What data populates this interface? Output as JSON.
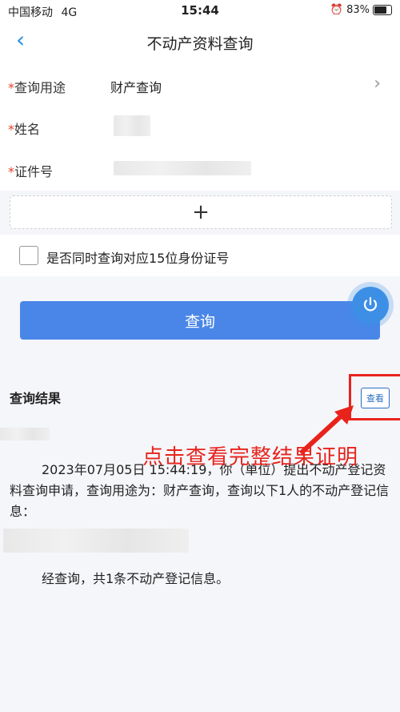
{
  "statusbar": {
    "carrier": "中国移动",
    "network": "4G",
    "time": "15:44",
    "battery": "83%"
  },
  "nav": {
    "title": "不动产资料查询"
  },
  "form": {
    "required_mark": "*",
    "purpose_label": "查询用途",
    "purpose_value": "财产查询",
    "name_label": "姓名",
    "id_label": "证件号"
  },
  "add": {
    "symbol": "+"
  },
  "checkbox": {
    "label": "是否同时查询对应15位身份证号",
    "checked": false
  },
  "query_button": {
    "label": "查询"
  },
  "results": {
    "title": "查询结果",
    "view_label": "查看",
    "paragraph": "2023年07月05日 15:44:19，你（单位）提出不动产登记资料查询申请，查询用途为：财产查询，查询以下1人的不动产登记信息：",
    "summary": "经查询，共1条不动产登记信息。"
  },
  "annotation": {
    "text": "点击查看完整结果证明"
  },
  "colors": {
    "accent": "#4a86e8",
    "required": "#e8412c",
    "annotation": "#e8231c"
  }
}
